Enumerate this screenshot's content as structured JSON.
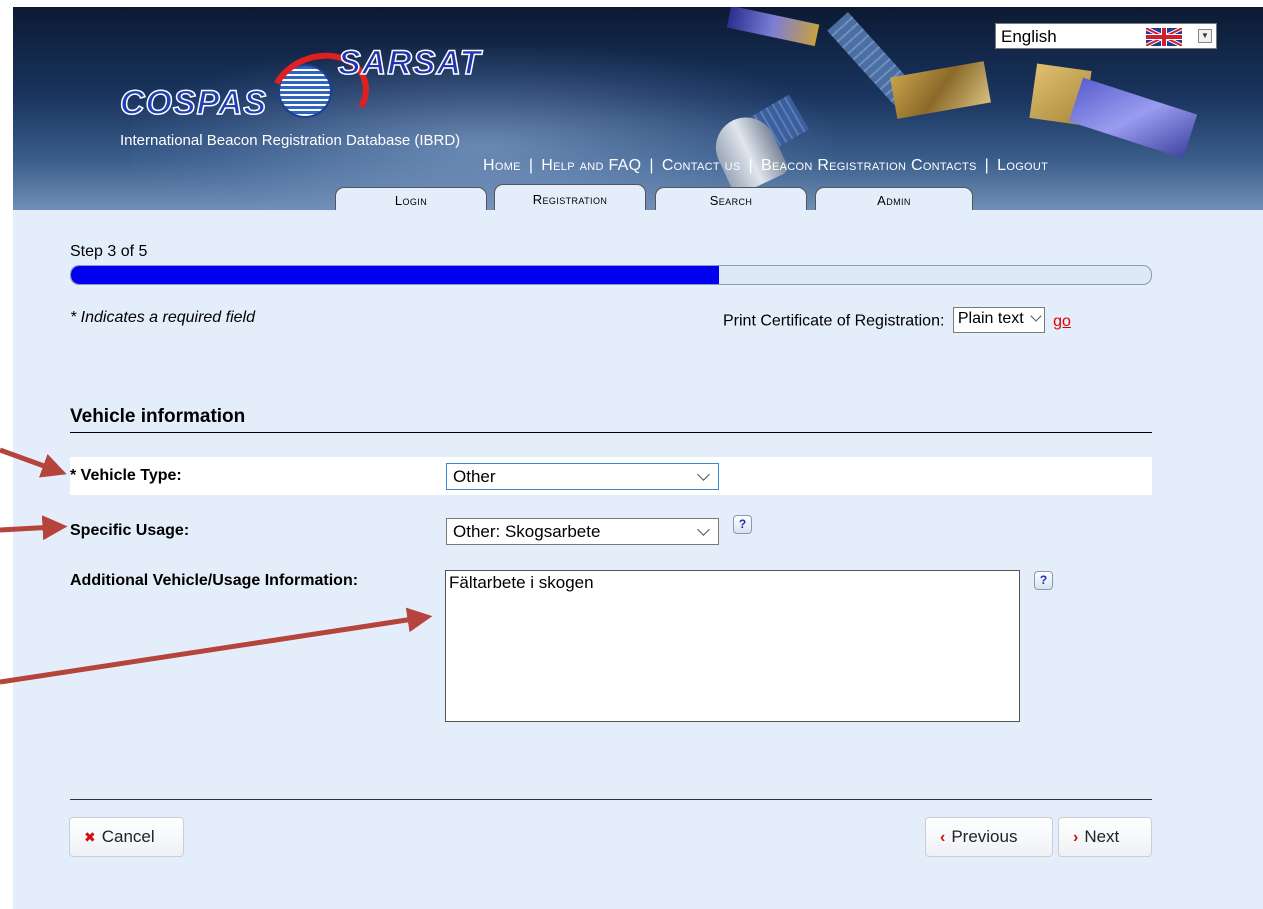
{
  "header": {
    "logo_cospas": "COSPAS",
    "logo_sarsat": "SARSAT",
    "site_subtitle": "International Beacon Registration Database (IBRD)",
    "language": "English",
    "top_nav": [
      "Home",
      "Help and FAQ",
      "Contact us",
      "Beacon Registration Contacts",
      "Logout"
    ],
    "tabs": [
      {
        "label": "Login",
        "active": false
      },
      {
        "label": "Registration",
        "active": true
      },
      {
        "label": "Search",
        "active": false
      },
      {
        "label": "Admin",
        "active": false
      }
    ]
  },
  "progress": {
    "step_text": "Step 3 of 5",
    "fraction": 0.6
  },
  "form": {
    "required_note": "* Indicates a required field",
    "print_label": "Print Certificate of Registration:",
    "print_format": "Plain text",
    "go_label": "go",
    "section_title": "Vehicle information",
    "vehicle_type_label": "* Vehicle Type:",
    "vehicle_type_value": "Other",
    "specific_usage_label": "Specific Usage:",
    "specific_usage_value": "Other: Skogsarbete",
    "additional_label": "Additional Vehicle/Usage Information:",
    "additional_value": "Fältarbete i skogen",
    "help_icon_text": "?"
  },
  "buttons": {
    "cancel": "Cancel",
    "previous": "Previous",
    "next": "Next"
  },
  "colors": {
    "progress_fill": "#0000ee",
    "go_link": "#e00000",
    "annotation_arrow": "#b5443c"
  }
}
